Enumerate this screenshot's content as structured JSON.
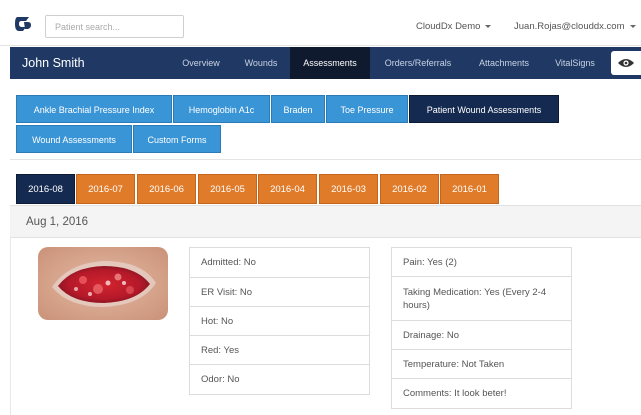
{
  "topbar": {
    "search_placeholder": "Patient search...",
    "org_menu": "CloudDx Demo",
    "user_menu": "Juan.Rojas@clouddx.com",
    "logo_icon": "clouddx-logo-icon",
    "accent": "#1f3864"
  },
  "patient": {
    "name": "John Smith",
    "nav": [
      {
        "label": "Overview",
        "active": false
      },
      {
        "label": "Wounds",
        "active": false
      },
      {
        "label": "Assessments",
        "active": true
      },
      {
        "label": "Orders/Referrals",
        "active": false
      },
      {
        "label": "Attachments",
        "active": false
      },
      {
        "label": "VitalSigns",
        "active": false
      }
    ],
    "view_icon": "eye-icon"
  },
  "assessment_types": [
    {
      "label": "Ankle Brachial Pressure Index",
      "active": false
    },
    {
      "label": "Hemoglobin A1c",
      "active": false
    },
    {
      "label": "Braden",
      "active": false
    },
    {
      "label": "Toe Pressure",
      "active": false
    },
    {
      "label": "Patient Wound Assessments",
      "active": true
    },
    {
      "label": "Wound Assessments",
      "active": false
    },
    {
      "label": "Custom Forms",
      "active": false
    }
  ],
  "months": [
    {
      "label": "2016-08",
      "active": true
    },
    {
      "label": "2016-07",
      "active": false
    },
    {
      "label": "2016-06",
      "active": false
    },
    {
      "label": "2016-05",
      "active": false
    },
    {
      "label": "2016-04",
      "active": false
    },
    {
      "label": "2016-03",
      "active": false
    },
    {
      "label": "2016-02",
      "active": false
    },
    {
      "label": "2016-01",
      "active": false
    }
  ],
  "assessment": {
    "date": "Aug 1, 2016",
    "left_fields": [
      "Admitted: No",
      "ER Visit: No",
      "Hot: No",
      "Red: Yes",
      "Odor: No"
    ],
    "right_fields": [
      "Pain: Yes (2)",
      "Taking Medication: Yes (Every 2-4 hours)",
      "Drainage: No",
      "Temperature: Not Taken",
      "Comments: It look beter!"
    ]
  },
  "colors": {
    "nav_bg": "#1f3864",
    "type_button": "#3a95d6",
    "month_tab": "#e07b2a",
    "active": "#152a50"
  }
}
